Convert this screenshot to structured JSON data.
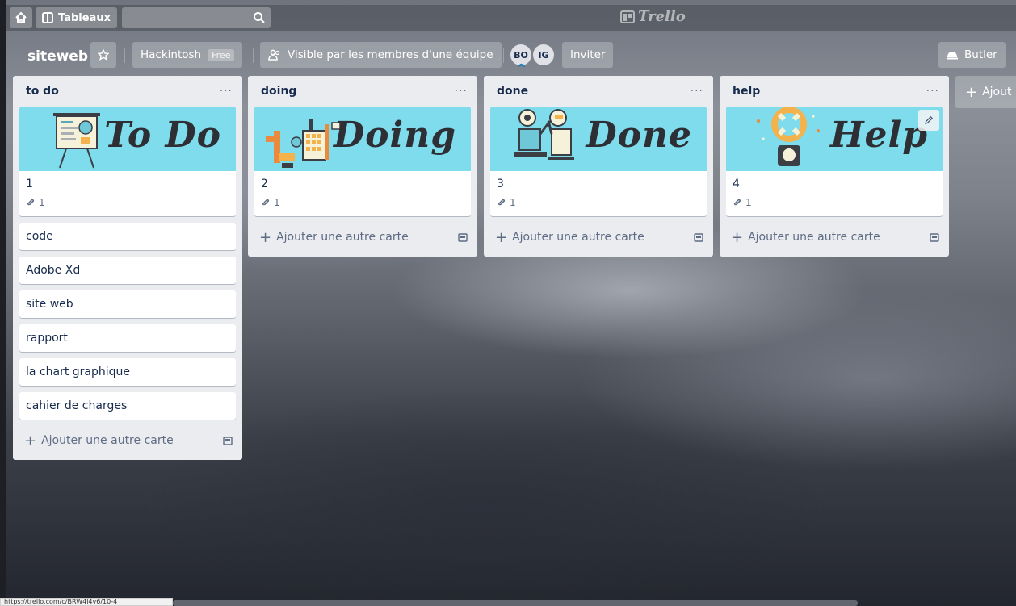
{
  "app": {
    "brand": "Trello",
    "boards_label": "Tableaux"
  },
  "board": {
    "title": "siteweb",
    "team_name": "Hackintosh",
    "team_badge": "Free",
    "visibility": "Visible par les membres d'une équipe",
    "members": [
      {
        "initials": "BO"
      },
      {
        "initials": "IG"
      }
    ],
    "invite_label": "Inviter",
    "butler_label": "Butler",
    "add_list_label": "Ajout"
  },
  "lists": [
    {
      "title": "to do",
      "cover": {
        "word": "To Do",
        "color": "#7fdcec"
      },
      "cover_card": {
        "title": "1",
        "attachments": "1"
      },
      "cards": [
        "code",
        "Adobe Xd",
        "site web",
        "rapport",
        "la chart graphique",
        "cahier de charges"
      ],
      "add_label": "Ajouter une autre carte"
    },
    {
      "title": "doing",
      "cover": {
        "word": "Doing",
        "color": "#7fdcec"
      },
      "cover_card": {
        "title": "2",
        "attachments": "1"
      },
      "cards": [],
      "add_label": "Ajouter une autre carte"
    },
    {
      "title": "done",
      "cover": {
        "word": "Done",
        "color": "#7fdcec"
      },
      "cover_card": {
        "title": "3",
        "attachments": "1"
      },
      "cards": [],
      "add_label": "Ajouter une autre carte"
    },
    {
      "title": "help",
      "cover": {
        "word": "Help",
        "color": "#7fdcec"
      },
      "cover_card": {
        "title": "4",
        "attachments": "1"
      },
      "cards": [],
      "add_label": "Ajouter une autre carte"
    }
  ],
  "status_bar": {
    "url": "https://trello.com/c/BRW4l4v6/10-4"
  }
}
